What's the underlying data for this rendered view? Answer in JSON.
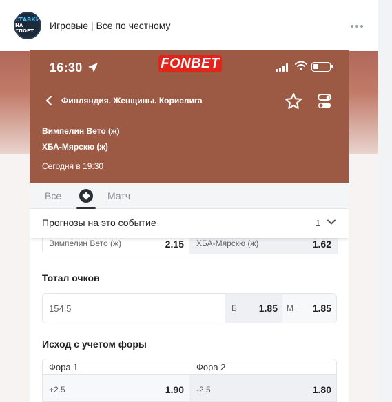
{
  "post": {
    "avatar_top": "СТАВКИ",
    "avatar_bottom": "НА СПОРТ",
    "channel_title": "Игровые | Все по честному"
  },
  "phone": {
    "status_time": "16:30",
    "brand": "FONBET",
    "league": "Финляндия. Женщины. Корислига",
    "team1": "Вимпелин Вето (ж)",
    "team2": "ХБА-Мярскю (ж)",
    "match_time": "Сегодня в 19:30"
  },
  "tabs": {
    "all": "Все",
    "match": "Матч"
  },
  "forecast": {
    "label": "Прогнозы на это событие",
    "count": "1"
  },
  "winner_odds": {
    "team1_label": "Вимпелин Вето (ж)",
    "team1_value": "2.15",
    "team2_label": "ХБА-Мярскю (ж)",
    "team2_value": "1.62"
  },
  "total": {
    "title": "Тотал очков",
    "line": "154.5",
    "over_label": "Б",
    "over_value": "1.85",
    "under_label": "М",
    "under_value": "1.85"
  },
  "handicap": {
    "title": "Исход с учетом форы",
    "col1_header": "Фора 1",
    "col2_header": "Фора 2",
    "col1_line": "+2.5",
    "col1_value": "1.90",
    "col2_line": "-2.5",
    "col2_value": "1.80"
  },
  "colors": {
    "header_bg": "#9c5a44",
    "brand_red": "#e0251c"
  }
}
